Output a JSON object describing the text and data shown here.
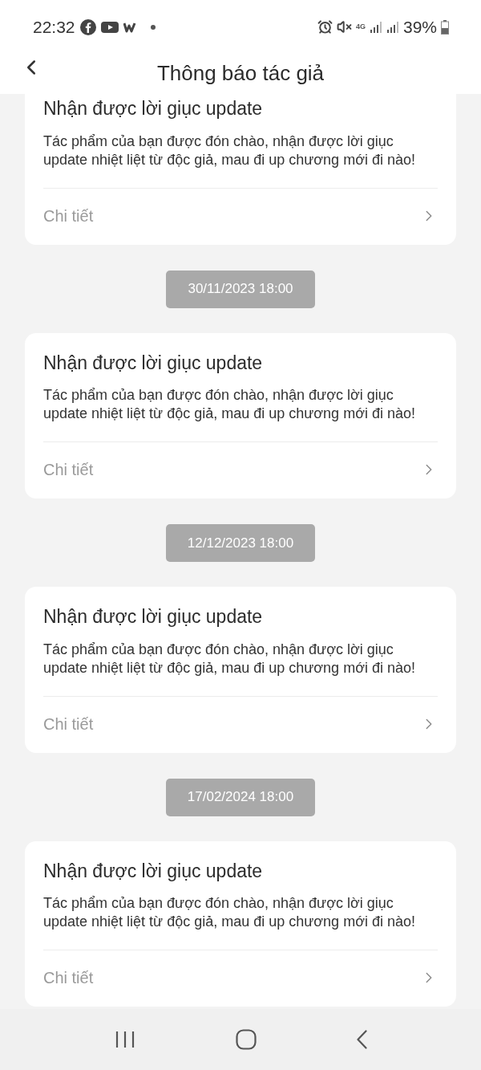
{
  "status_bar": {
    "time": "22:32",
    "network": "4G",
    "battery": "39%"
  },
  "header": {
    "title": "Thông báo tác giả"
  },
  "notifications": [
    {
      "title": "Nhận được lời giục update",
      "body": "Tác phẩm của bạn được đón chào, nhận được lời giục update nhiệt liệt từ độc giả, mau đi up chương mới đi nào!",
      "link": "Chi tiết"
    },
    {
      "date": "30/11/2023 18:00",
      "title": "Nhận được lời giục update",
      "body": "Tác phẩm của bạn được đón chào, nhận được lời giục update nhiệt liệt từ độc giả, mau đi up chương mới đi nào!",
      "link": "Chi tiết"
    },
    {
      "date": "12/12/2023 18:00",
      "title": "Nhận được lời giục update",
      "body": "Tác phẩm của bạn được đón chào, nhận được lời giục update nhiệt liệt từ độc giả, mau đi up chương mới đi nào!",
      "link": "Chi tiết"
    },
    {
      "date": "17/02/2024 18:00",
      "title": "Nhận được lời giục update",
      "body": "Tác phẩm của bạn được đón chào, nhận được lời giục update nhiệt liệt từ độc giả, mau đi up chương mới đi nào!",
      "link": "Chi tiết"
    }
  ]
}
